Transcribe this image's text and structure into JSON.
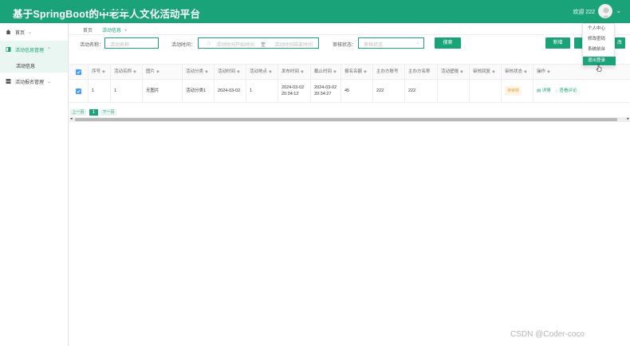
{
  "app": {
    "title": "基于SpringBoot的中老年人文化活动平台"
  },
  "header": {
    "welcome": "欢迎 222",
    "caret": "⌄"
  },
  "user_menu": {
    "items": [
      "个人中心",
      "修改密码",
      "系统前台",
      "退出登录"
    ],
    "highlighted": "退出登录"
  },
  "sidebar": {
    "groups": [
      {
        "label": "首页",
        "chevron": "⌄",
        "icon": "home-icon"
      },
      {
        "label": "活动信息管理",
        "chevron": "⌃",
        "icon": "grid-icon",
        "active": true
      },
      {
        "label": "活动报名管理",
        "chevron": "⌄",
        "icon": "grid-icon"
      }
    ],
    "sub_items": [
      {
        "label": "活动信息"
      }
    ]
  },
  "tabs": [
    {
      "label": "首页"
    },
    {
      "label": "活动信息",
      "closable": "×"
    }
  ],
  "filters": {
    "name_label": "活动名称：",
    "name_placeholder": "活动名称",
    "time_label": "活动时间：",
    "time_start_placeholder": "活动时间开始时间",
    "time_sep": "至",
    "time_end_placeholder": "活动时间结束时间",
    "status_label": "审核状态：",
    "status_placeholder": "审核状态",
    "search_button": "搜索",
    "add_button": "新增",
    "right_button_partial": "改"
  },
  "table": {
    "headers": [
      "序号",
      "活动名称",
      "图片",
      "活动分类",
      "活动时间",
      "活动地点",
      "发布时间",
      "截止时间",
      "报名名额",
      "主办方账号",
      "主办方名称",
      "活动壁报",
      "审核回复",
      "审核状态",
      "操作"
    ],
    "rows": [
      {
        "index": "1",
        "name": "1",
        "image": "无图片",
        "category": "活动分类1",
        "time": "2024-03-02",
        "place": "1",
        "publish_date": "2024-03-02",
        "publish_time": "20:34:12",
        "deadline_date": "2024-03-02",
        "deadline_time": "20:34:27",
        "quota": "45",
        "host_account": "222",
        "host_name": "222",
        "poster": "",
        "review_reply": "",
        "status": "待审核",
        "op_detail": "详情",
        "op_comment": "查看评论"
      }
    ]
  },
  "pagination": {
    "prev": "上一页",
    "current": "1",
    "next": "下一页"
  },
  "watermark": "CSDN @Coder-coco",
  "colors": {
    "primary": "#1aa378",
    "checkbox": "#409eff",
    "pending": "#e6a23c"
  }
}
